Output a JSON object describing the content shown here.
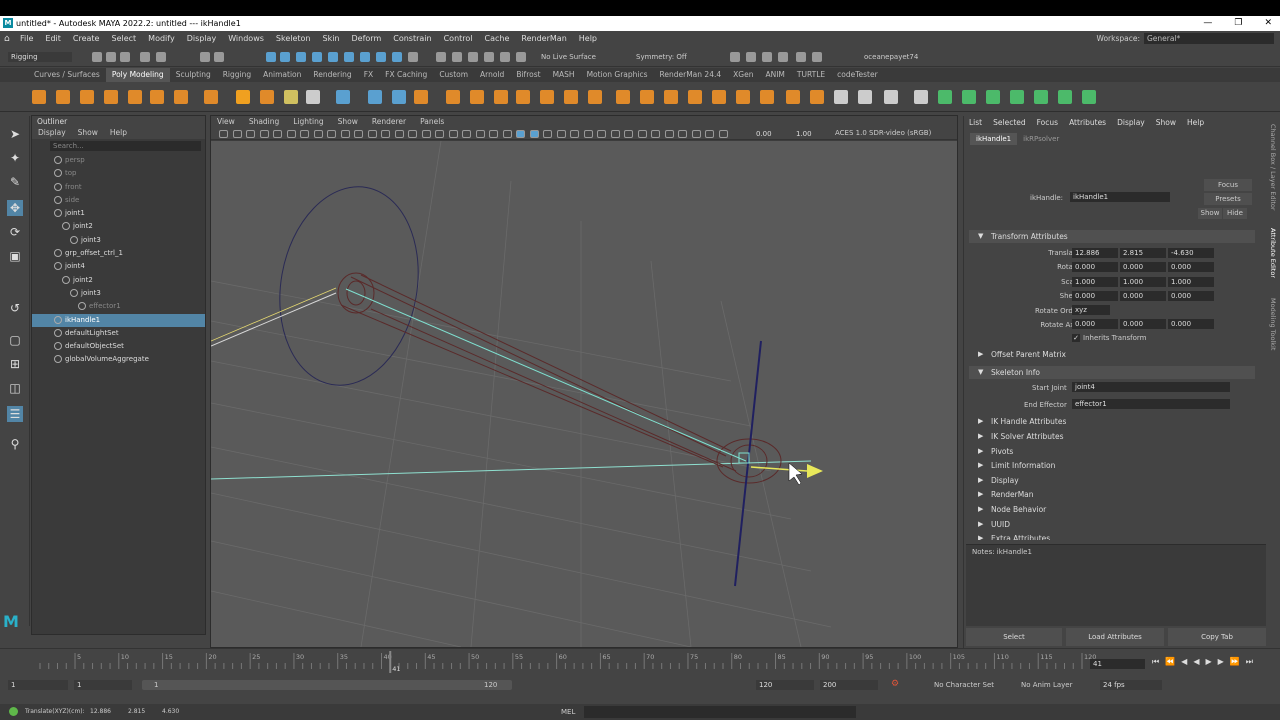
{
  "titlebar": {
    "title": "untitled* - Autodesk MAYA 2022.2: untitled   ---  ikHandle1"
  },
  "menus": [
    "File",
    "Edit",
    "Create",
    "Select",
    "Modify",
    "Display",
    "Windows",
    "Skeleton",
    "Skin",
    "Deform",
    "Constrain",
    "Control",
    "Cache",
    "RenderMan",
    "Help"
  ],
  "workspace": {
    "label": "Workspace:",
    "value": "General*"
  },
  "statusline": {
    "menuset": "Rigging",
    "live_surface": "No Live Surface",
    "symmetry": "Symmetry: Off",
    "user": "oceanepayet74"
  },
  "shelf_tabs": [
    "Curves / Surfaces",
    "Poly Modeling",
    "Sculpting",
    "Rigging",
    "Animation",
    "Rendering",
    "FX",
    "FX Caching",
    "Custom",
    "Arnold",
    "Bifrost",
    "MASH",
    "Motion Graphics",
    "RenderMan 24.4",
    "XGen",
    "ANIM",
    "TURTLE",
    "codeTester"
  ],
  "outliner": {
    "title": "Outliner",
    "menu": [
      "Display",
      "Show",
      "Help"
    ],
    "search_placeholder": "Search...",
    "nodes": [
      {
        "label": "persp",
        "indent": 1
      },
      {
        "label": "top",
        "indent": 1
      },
      {
        "label": "front",
        "indent": 1
      },
      {
        "label": "side",
        "indent": 1
      },
      {
        "label": "joint1",
        "indent": 1
      },
      {
        "label": "joint2",
        "indent": 2
      },
      {
        "label": "joint3",
        "indent": 3
      },
      {
        "label": "grp_offset_ctrl_1",
        "indent": 1
      },
      {
        "label": "joint4",
        "indent": 1
      },
      {
        "label": "joint2",
        "indent": 2
      },
      {
        "label": "joint3",
        "indent": 3
      },
      {
        "label": "effector1",
        "indent": 4
      },
      {
        "label": "ikHandle1",
        "indent": 1
      },
      {
        "label": "defaultLightSet",
        "indent": 1
      },
      {
        "label": "defaultObjectSet",
        "indent": 1
      },
      {
        "label": "globalVolumeAggregate",
        "indent": 1
      }
    ]
  },
  "viewport": {
    "menu": [
      "View",
      "Shading",
      "Lighting",
      "Show",
      "Renderer",
      "Panels"
    ],
    "exposure": "0.00",
    "gamma": "1.00",
    "colorspace": "ACES 1.0 SDR-video (sRGB)"
  },
  "attr": {
    "menu": [
      "List",
      "Selected",
      "Focus",
      "Attributes",
      "Display",
      "Show",
      "Help"
    ],
    "tabs": [
      "ikHandle1",
      "ikRPsolver"
    ],
    "node_label": "ikHandle:",
    "node_value": "ikHandle1",
    "focus": "Focus",
    "presets": "Presets",
    "show": "Show",
    "hide": "Hide",
    "transform_title": "Transform Attributes",
    "translate_label": "Translate",
    "translate": [
      "12.886",
      "2.815",
      "-4.630"
    ],
    "rotate_label": "Rotate",
    "rotate": [
      "0.000",
      "0.000",
      "0.000"
    ],
    "scale_label": "Scale",
    "scale": [
      "1.000",
      "1.000",
      "1.000"
    ],
    "shear_label": "Shear",
    "shear": [
      "0.000",
      "0.000",
      "0.000"
    ],
    "rotate_order_label": "Rotate Order",
    "rotate_order": "xyz",
    "rotate_axis_label": "Rotate Axis",
    "rotate_axis": [
      "0.000",
      "0.000",
      "0.000"
    ],
    "inherits": "Inherits Transform",
    "offset_title": "Offset Parent Matrix",
    "skeleton_title": "Skeleton Info",
    "start_joint_label": "Start Joint",
    "start_joint": "joint4",
    "end_effector_label": "End Effector",
    "end_effector": "effector1",
    "sections": [
      "IK Handle Attributes",
      "IK Solver Attributes",
      "Pivots",
      "Limit Information",
      "Display",
      "RenderMan",
      "Node Behavior",
      "UUID",
      "Extra Attributes"
    ],
    "notes": "Notes: ikHandle1",
    "buttons": [
      "Select",
      "Load Attributes",
      "Copy Tab"
    ]
  },
  "side_tabs": [
    "Channel Box / Layer Editor",
    "Attribute Editor",
    "Modeling Toolkit"
  ],
  "timeline": {
    "ticks": [
      "5",
      "10",
      "15",
      "20",
      "25",
      "30",
      "35",
      "40",
      "45",
      "50",
      "55",
      "60",
      "65",
      "70",
      "75",
      "80",
      "85",
      "90",
      "95",
      "100",
      "105",
      "110",
      "115",
      "120"
    ],
    "current": "41",
    "current_field": "41"
  },
  "range": {
    "start": "1",
    "start2": "1",
    "slider_start": "1",
    "slider_end": "120",
    "end": "120",
    "end2": "200",
    "char_set": "No Character Set",
    "anim_layer": "No Anim Layer",
    "fps": "24 fps"
  },
  "cmdline": {
    "feedback_label": "Translate(XYZ)(cm):",
    "tx": "12.886",
    "ty": "2.815",
    "tz": "4.630",
    "mel": "MEL"
  }
}
